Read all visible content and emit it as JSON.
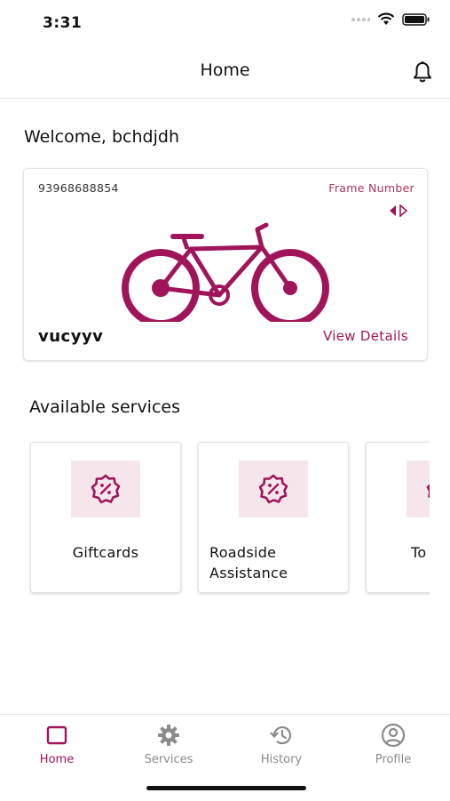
{
  "status": {
    "time": "3:31"
  },
  "header": {
    "title": "Home"
  },
  "welcome": "Welcome, bchdjdh",
  "bike": {
    "serial": "93968688854",
    "frame_label": "Frame Number",
    "name": "vucyyv",
    "view_details": "View Details",
    "accent": "#a0155a"
  },
  "services": {
    "title": "Available services",
    "items": [
      {
        "label": "Giftcards",
        "icon": "discount-badge-icon"
      },
      {
        "label": "Roadside Assistance",
        "icon": "discount-badge-icon"
      },
      {
        "label": "To",
        "icon": "discount-badge-icon"
      }
    ]
  },
  "tabs": [
    {
      "label": "Home",
      "icon": "home-square-icon",
      "active": true
    },
    {
      "label": "Services",
      "icon": "gear-icon",
      "active": false
    },
    {
      "label": "History",
      "icon": "history-icon",
      "active": false
    },
    {
      "label": "Profile",
      "icon": "user-circle-icon",
      "active": false
    }
  ]
}
